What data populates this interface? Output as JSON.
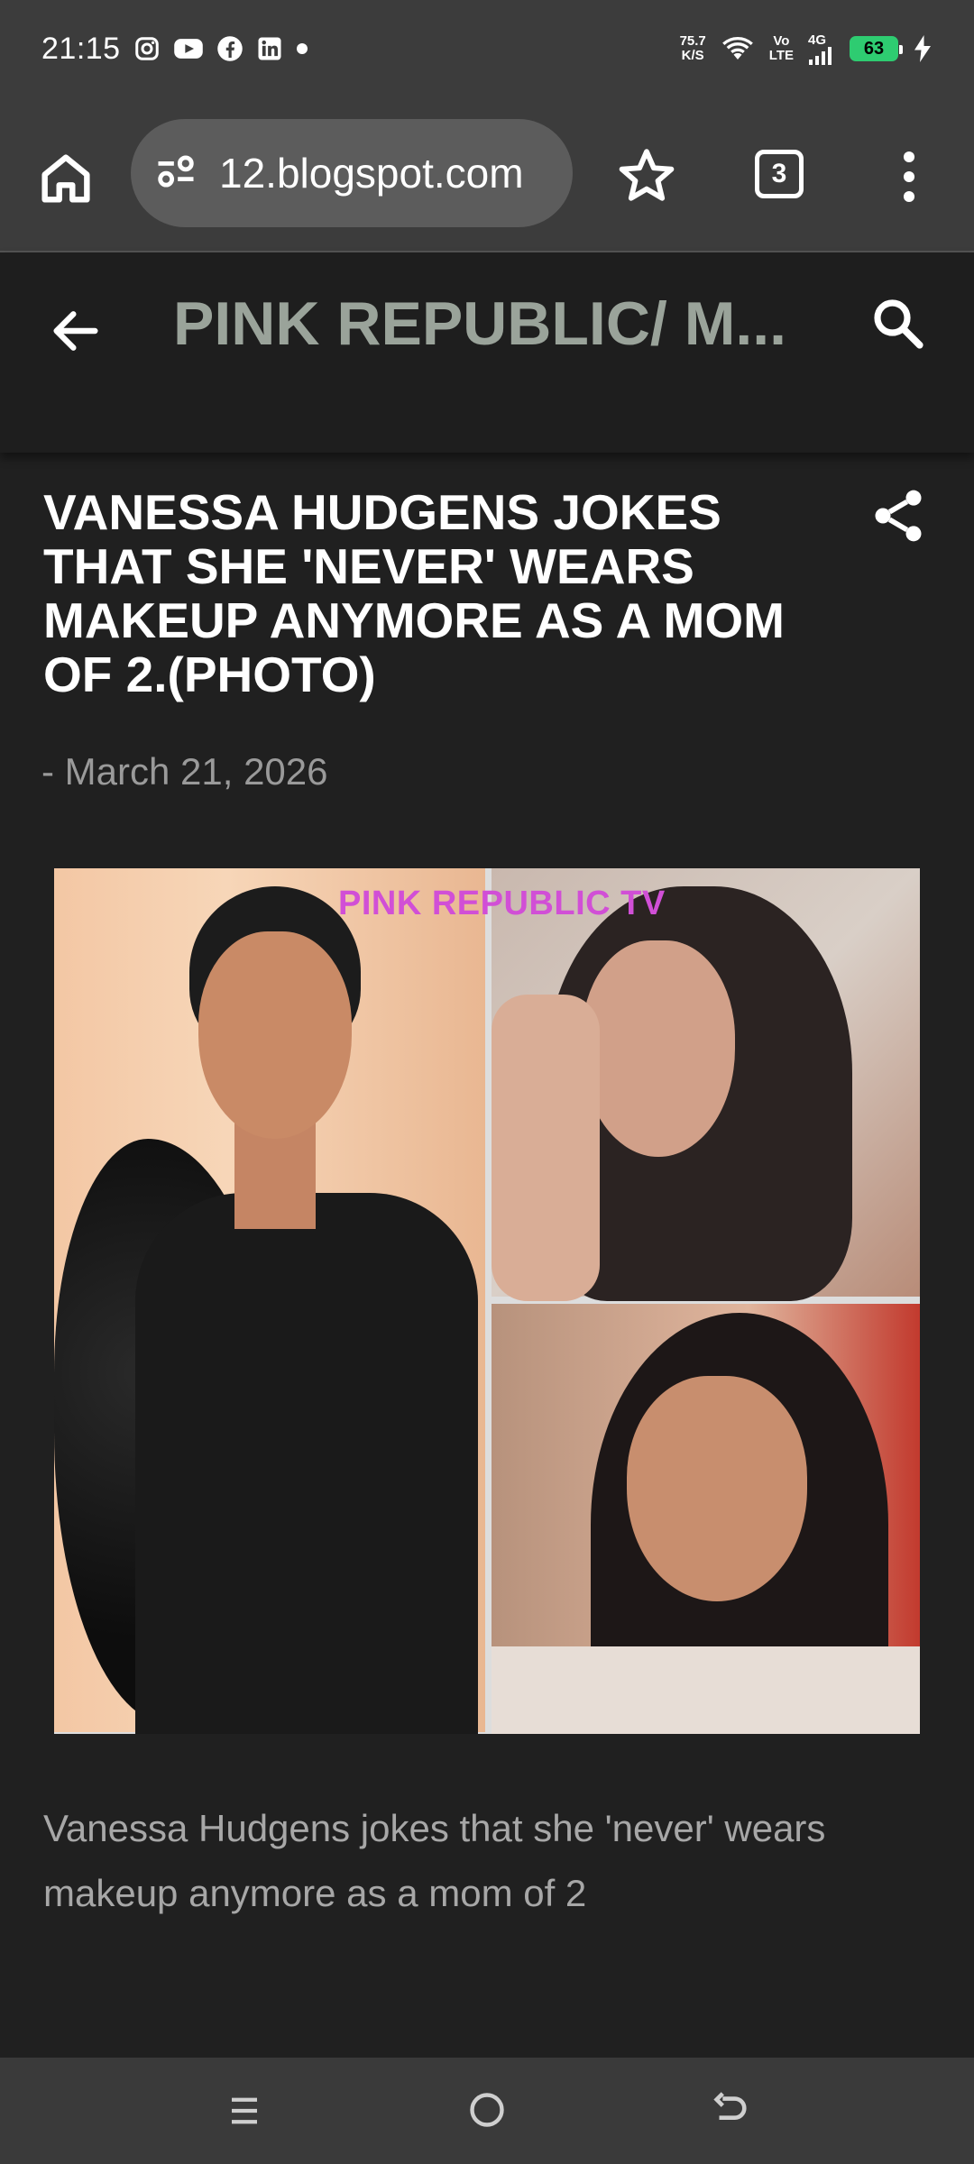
{
  "status_bar": {
    "time": "21:15",
    "net_speed_value": "75.7",
    "net_speed_unit": "K/S",
    "volte_top": "Vo",
    "volte_bottom": "LTE",
    "network": "4G",
    "battery": "63"
  },
  "browser": {
    "url": "12.blogspot.com",
    "tab_count": "3"
  },
  "blog": {
    "title": "PINK REPUBLIC/ M..."
  },
  "post": {
    "title": "VANESSA HUDGENS JOKES THAT SHE 'NEVER' WEARS MAKEUP ANYMORE AS A MOM OF 2.(PHOTO)",
    "date": "- March 21, 2026",
    "image_watermark": "PINK REPUBLIC TV",
    "body": " Vanessa Hudgens jokes that she 'never' wears makeup anymore as a mom of 2"
  },
  "colors": {
    "page_bg": "#202020",
    "chrome_bg": "#3c3c3c",
    "blog_title": "#9aa39a",
    "battery": "#2ecc71",
    "watermark": "#d14fd6"
  },
  "icons": [
    "instagram-icon",
    "youtube-icon",
    "facebook-icon",
    "linkedin-icon",
    "wifi-icon",
    "signal-icon",
    "charging-icon",
    "home-icon",
    "site-settings-icon",
    "star-icon",
    "more-vert-icon",
    "back-arrow-icon",
    "search-icon",
    "share-icon",
    "nav-menu-icon",
    "nav-home-icon",
    "nav-back-icon"
  ]
}
